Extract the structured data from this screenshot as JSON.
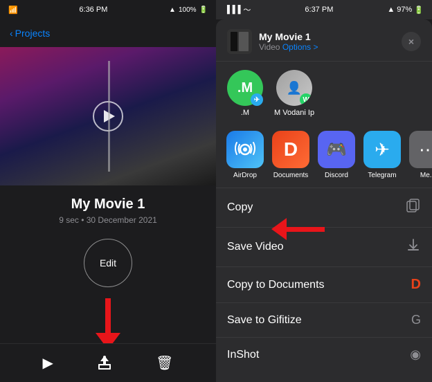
{
  "left": {
    "statusBar": {
      "time": "6:36 PM",
      "battery": "100%"
    },
    "nav": {
      "backLabel": "Projects"
    },
    "movie": {
      "title": "My Movie 1",
      "meta": "9 sec • 30 December 2021"
    },
    "editButton": "Edit",
    "toolbar": {
      "playIcon": "▶",
      "shareIcon": "⬆",
      "deleteIcon": "🗑"
    }
  },
  "right": {
    "statusBar": {
      "time": "6:37 PM",
      "battery": "97%"
    },
    "shareSheet": {
      "title": "My Movie 1",
      "videoLabel": "Video",
      "optionsLabel": "Options >",
      "closeLabel": "×"
    },
    "contacts": [
      {
        "initial": ".M",
        "bg": "green-bg",
        "badge": "telegram",
        "name": ".M"
      },
      {
        "initial": "",
        "bg": "gray-bg",
        "badge": "whatsapp",
        "name": "M Vodani Ip"
      }
    ],
    "apps": [
      {
        "name": "AirDrop",
        "class": "airdrop",
        "icon": "📶"
      },
      {
        "name": "Documents",
        "class": "documents",
        "icon": "D"
      },
      {
        "name": "Discord",
        "class": "discord",
        "icon": "💬"
      },
      {
        "name": "Telegram",
        "class": "telegram",
        "icon": "✈"
      },
      {
        "name": "Me...",
        "class": "airdrop",
        "icon": "⋯"
      }
    ],
    "actions": [
      {
        "label": "Copy",
        "icon": "⎘"
      },
      {
        "label": "Save Video",
        "icon": "⬇"
      },
      {
        "label": "Copy to Documents",
        "icon": "D"
      },
      {
        "label": "Save to Gifitize",
        "icon": "G"
      },
      {
        "label": "InShot",
        "icon": "◉"
      }
    ]
  }
}
